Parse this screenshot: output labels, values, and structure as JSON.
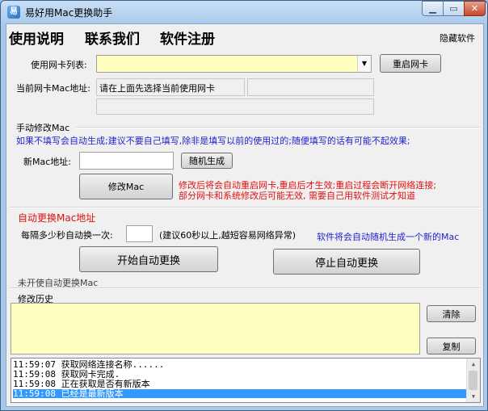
{
  "window": {
    "title": "易好用Mac更换助手",
    "icon": "app-icon"
  },
  "menu": {
    "usage": "使用说明",
    "contact": "联系我们",
    "register": "软件注册",
    "hide": "隐藏软件"
  },
  "nic": {
    "list_label": "使用网卡列表:",
    "selected": "",
    "restart_button": "重启网卡",
    "mac_label": "当前网卡Mac地址:",
    "mac_value": "请在上面先选择当前使用网卡",
    "mac_value2": "",
    "mac_value3": ""
  },
  "manual": {
    "title": "手动修改Mac",
    "hint": "如果不填写会自动生成;建议不要自己填写,除非是填写以前的使用过的;随便填写的话有可能不起效果;",
    "new_mac_label": "新Mac地址:",
    "new_mac_value": "",
    "random_button": "随机生成",
    "modify_button": "修改Mac",
    "warning_line1": "修改后将会自动重启网卡,重启后才生效;重启过程会断开网络连接;",
    "warning_line2": "部分网卡和系统修改后可能无效, 需要自己用软件测试才知道"
  },
  "auto": {
    "title": "自动更换Mac地址",
    "interval_label": "每隔多少秒自动换一次:",
    "interval_value": "",
    "interval_hint": "(建议60秒以上,越短容易网络异常)",
    "auto_note": "软件将会自动随机生成一个新的Mac",
    "start_button": "开始自动更换",
    "stop_button": "停止自动更换",
    "status": "未开使自动更换Mac"
  },
  "history": {
    "title": "修改历史",
    "clear_button": "清除",
    "copy_button": "复制"
  },
  "log": [
    "11:59:07 获取网络连接名称......",
    "11:59:08 获取网卡完成.",
    "11:59:08 正在获取是否有新版本",
    "11:59:08 已经是最新版本"
  ],
  "colors": {
    "highlight_yellow": "#ffffc0",
    "hint_blue": "#1f1fd0",
    "warning_red": "#e01010",
    "selection": "#3399ff"
  }
}
